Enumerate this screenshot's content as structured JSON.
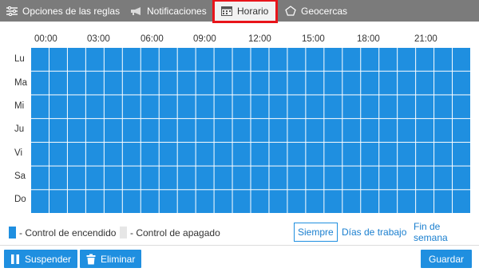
{
  "tabs": [
    {
      "label": "Opciones de las reglas",
      "icon": "sliders-icon"
    },
    {
      "label": "Notificaciones",
      "icon": "megaphone-icon"
    },
    {
      "label": "Horario",
      "icon": "calendar-icon",
      "active": true
    },
    {
      "label": "Geocercas",
      "icon": "pentagon-icon"
    }
  ],
  "hours": [
    "00:00",
    "03:00",
    "06:00",
    "09:00",
    "12:00",
    "15:00",
    "18:00",
    "21:00"
  ],
  "days": [
    "Lu",
    "Ma",
    "Mi",
    "Ju",
    "Vi",
    "Sa",
    "Do"
  ],
  "schedule": {
    "columns": 24,
    "on_color": "#1f8fe0",
    "off_color": "#e6e6e6",
    "all_on": true
  },
  "legend": {
    "on_label": "- Control de encendido",
    "off_label": "- Control de apagado"
  },
  "filters": {
    "always": "Siempre",
    "workdays": "Días de trabajo",
    "weekend": "Fin de semana"
  },
  "buttons": {
    "suspend": "Suspender",
    "delete": "Eliminar",
    "save": "Guardar"
  },
  "colors": {
    "accent": "#1f8fe0",
    "tabbar": "#7b7b7b",
    "active_tab_border": "#e8141a"
  }
}
